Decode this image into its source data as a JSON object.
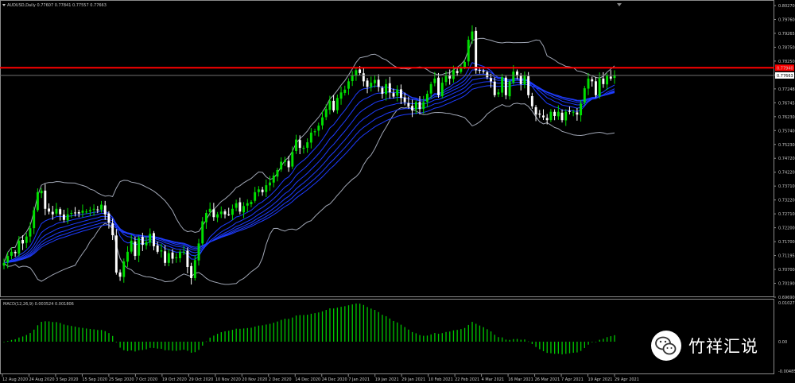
{
  "window": {
    "symbol_info": "AUDUSD,Daily  0.77607 0.77841 0.77557 0.77663",
    "indicator_label": "MACD(12,26,9) 0.003524 0.001806",
    "current_price_label": "0.77663",
    "resistance_price_label": "0.77940"
  },
  "price_axis": {
    "labels": [
      "0.80270",
      "0.79760",
      "0.79265",
      "0.78750",
      "0.78250",
      "0.77745",
      "0.77248",
      "0.76745",
      "0.76230",
      "0.75740",
      "0.75230",
      "0.74720",
      "0.74220",
      "0.73710",
      "0.73220",
      "0.72710",
      "0.72200",
      "0.71700",
      "0.71195",
      "0.70700",
      "0.70190",
      "0.69690"
    ],
    "range": [
      0.6969,
      0.8027
    ]
  },
  "macd_axis": {
    "labels": [
      "0.010271",
      "0.00",
      "-0.00485"
    ]
  },
  "date_axis": {
    "labels": [
      "12 Aug 2020",
      "24 Aug 2020",
      "3 Sep 2020",
      "15 Sep 2020",
      "25 Sep 2020",
      "7 Oct 2020",
      "19 Oct 2020",
      "29 Oct 2020",
      "10 Nov 2020",
      "20 Nov 2020",
      "2 Dec 2020",
      "14 Dec 2020",
      "24 Dec 2020",
      "7 Jan 2021",
      "19 Jan 2021",
      "29 Jan 2021",
      "10 Feb 2021",
      "22 Feb 2021",
      "4 Mar 2021",
      "16 Mar 2021",
      "26 Mar 2021",
      "7 Apr 2021",
      "19 Apr 2021",
      "29 Apr 2021"
    ]
  },
  "watermark": {
    "text": "竹祥汇说",
    "icon": "wechat-icon"
  },
  "colors": {
    "bull": "#00e000",
    "bear": "#ffffff",
    "resistance": "#ff0000",
    "bands": "#a0a6b4",
    "ma": "#1e3cff",
    "macd": "#00c800"
  },
  "chart_data": {
    "type": "candlestick",
    "y_range": [
      0.6969,
      0.8027
    ],
    "resistance_level": 0.7794,
    "current_price": 0.77663,
    "closes": [
      0.709,
      0.7115,
      0.713,
      0.7125,
      0.717,
      0.716,
      0.7185,
      0.7215,
      0.728,
      0.7345,
      0.735,
      0.7285,
      0.7275,
      0.7265,
      0.7285,
      0.7265,
      0.7245,
      0.7265,
      0.727,
      0.727,
      0.7268,
      0.7278,
      0.7275,
      0.728,
      0.7285,
      0.728,
      0.73,
      0.7265,
      0.7235,
      0.719,
      0.7055,
      0.704,
      0.7095,
      0.713,
      0.717,
      0.7115,
      0.718,
      0.7155,
      0.7165,
      0.7195,
      0.715,
      0.713,
      0.7135,
      0.709,
      0.7125,
      0.7105,
      0.711,
      0.713,
      0.713,
      0.7075,
      0.7035,
      0.71,
      0.716,
      0.724,
      0.727,
      0.7285,
      0.7255,
      0.7265,
      0.7275,
      0.7265,
      0.7265,
      0.7285,
      0.7305,
      0.7275,
      0.7295,
      0.7305,
      0.731,
      0.7345,
      0.7355,
      0.7345,
      0.737,
      0.738,
      0.7405,
      0.7425,
      0.7455,
      0.746,
      0.7435,
      0.749,
      0.7535,
      0.7505,
      0.7505,
      0.7525,
      0.756,
      0.7565,
      0.7585,
      0.7615,
      0.7645,
      0.7675,
      0.764,
      0.7685,
      0.7705,
      0.7715,
      0.7745,
      0.7765,
      0.7785,
      0.7775,
      0.7745,
      0.7725,
      0.774,
      0.775,
      0.7725,
      0.77,
      0.7735,
      0.7705,
      0.769,
      0.7715,
      0.7685,
      0.767,
      0.7655,
      0.764,
      0.767,
      0.7645,
      0.767,
      0.77,
      0.7735,
      0.7755,
      0.7695,
      0.774,
      0.7765,
      0.7755,
      0.7785,
      0.7775,
      0.7795,
      0.7815,
      0.7895,
      0.7925,
      0.7785,
      0.7785,
      0.778,
      0.776,
      0.7745,
      0.7695,
      0.7705,
      0.776,
      0.7695,
      0.7745,
      0.778,
      0.7765,
      0.7735,
      0.7765,
      0.7695,
      0.7655,
      0.7625,
      0.7625,
      0.7615,
      0.7605,
      0.7635,
      0.762,
      0.7635,
      0.7605,
      0.7635,
      0.7635,
      0.7635,
      0.7625,
      0.7665,
      0.772,
      0.7755,
      0.7745,
      0.7695,
      0.7755,
      0.7735,
      0.7765,
      0.7755,
      0.7766
    ]
  }
}
